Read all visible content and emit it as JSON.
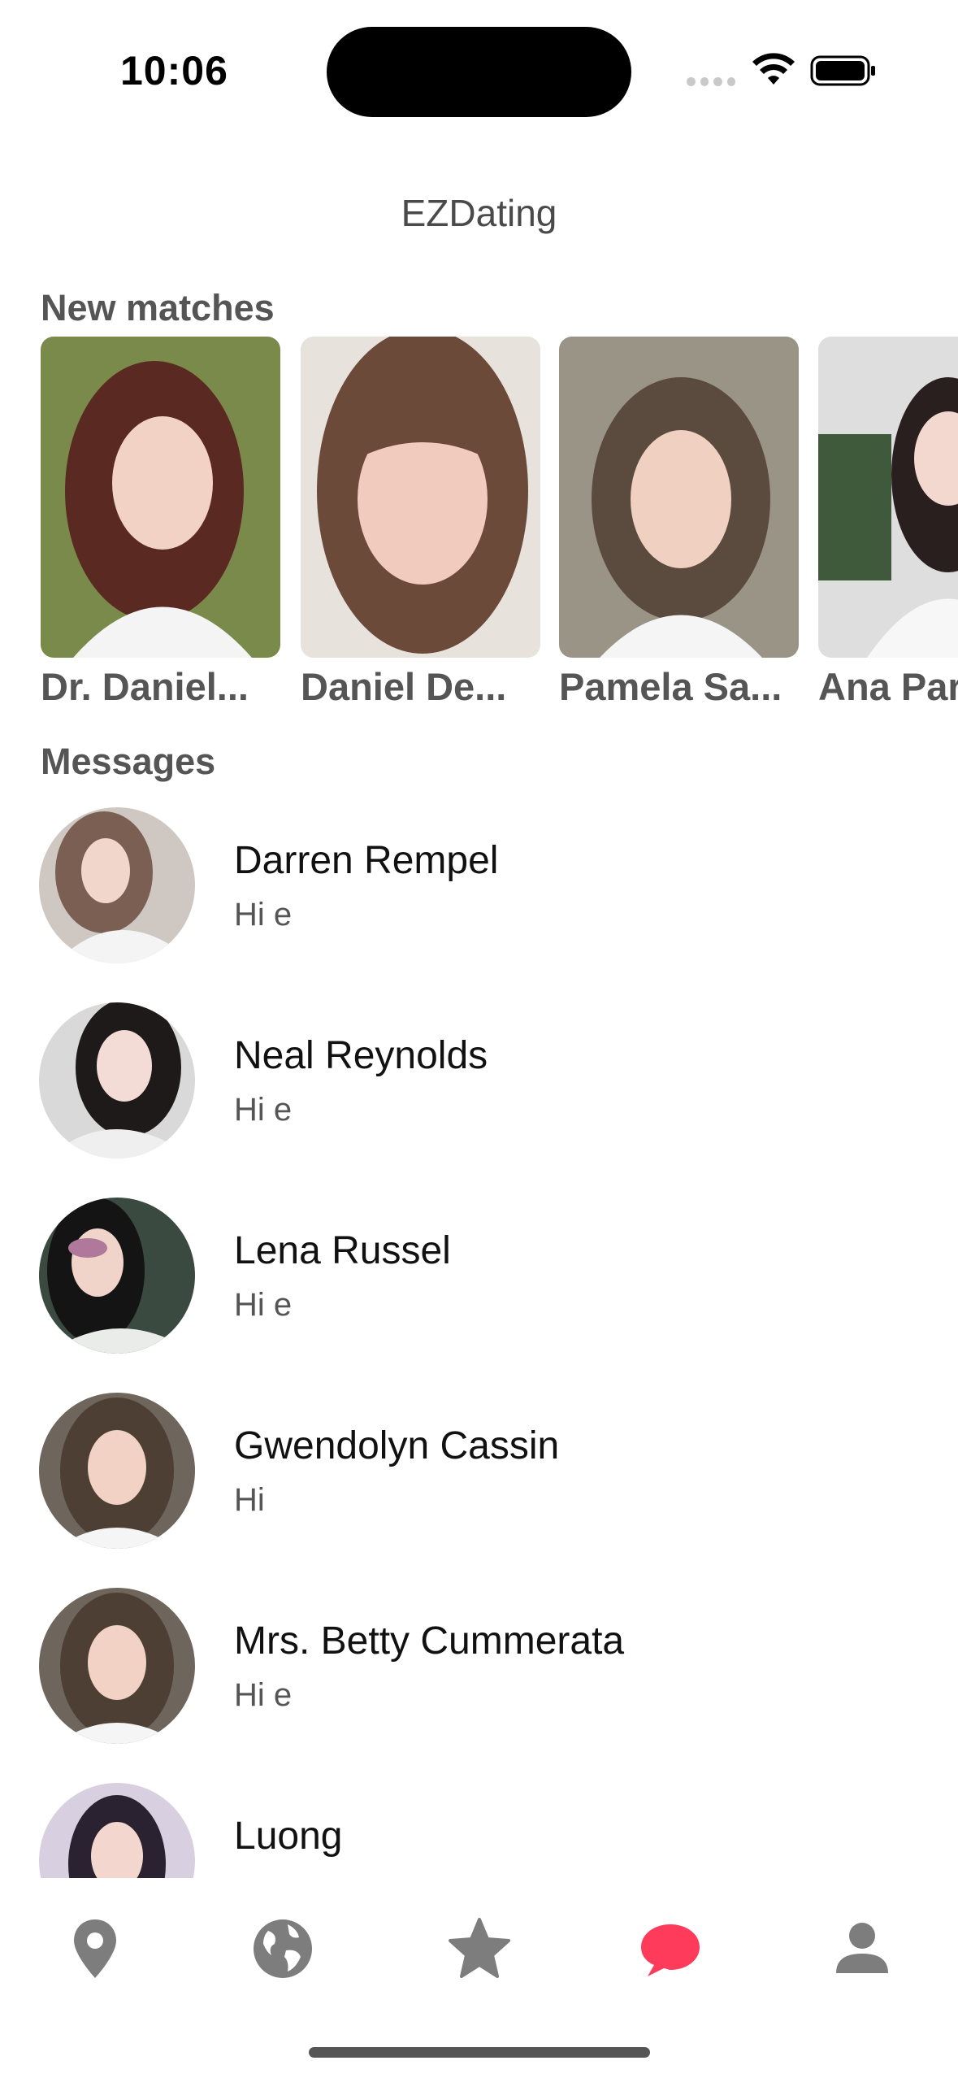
{
  "status": {
    "time": "10:06"
  },
  "app": {
    "title": "EZDating"
  },
  "sections": {
    "new_matches": "New matches",
    "messages": "Messages"
  },
  "matches": [
    {
      "name": "Dr. Daniel..."
    },
    {
      "name": "Daniel De..."
    },
    {
      "name": "Pamela Sa..."
    },
    {
      "name": "Ana Par"
    }
  ],
  "messages": [
    {
      "name": "Darren Rempel",
      "preview": "Hi e"
    },
    {
      "name": "Neal Reynolds",
      "preview": "Hi e"
    },
    {
      "name": "Lena Russel",
      "preview": "Hi e"
    },
    {
      "name": "Gwendolyn Cassin",
      "preview": "Hi"
    },
    {
      "name": "Mrs. Betty Cummerata",
      "preview": "Hi e"
    },
    {
      "name": "Luong",
      "preview": ""
    }
  ],
  "tabs": [
    {
      "icon": "location-pin-icon",
      "active": false
    },
    {
      "icon": "globe-icon",
      "active": false
    },
    {
      "icon": "star-icon",
      "active": false
    },
    {
      "icon": "chat-bubble-icon",
      "active": true
    },
    {
      "icon": "person-icon",
      "active": false
    }
  ],
  "colors": {
    "accent": "#ff3b5c",
    "inactive_icon": "#7d7d7d",
    "section_title": "#555555"
  }
}
